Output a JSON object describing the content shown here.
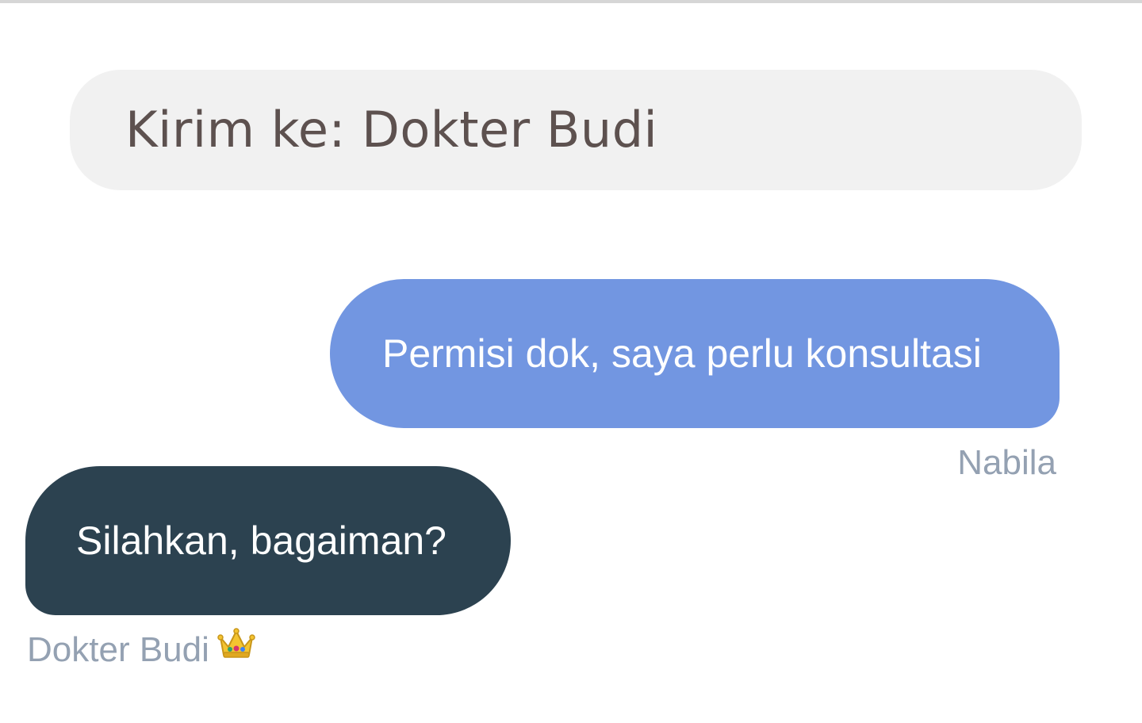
{
  "recipient": {
    "label": "Kirim ke: Dokter Budi"
  },
  "messages": [
    {
      "direction": "outgoing",
      "text": "Permisi dok, saya perlu konsultasi",
      "sender": "Nabila",
      "bubble_color": "#7296e1"
    },
    {
      "direction": "incoming",
      "text": "Silahkan, bagaiman?",
      "sender": "Dokter Budi",
      "sender_badge_icon": "crown-icon",
      "bubble_color": "#2c4250"
    }
  ],
  "colors": {
    "background": "#ffffff",
    "recipient_bar": "#f1f1f1",
    "recipient_text": "#5d514f",
    "sender_text": "#94a1b2",
    "bubble_text": "#ffffff"
  }
}
